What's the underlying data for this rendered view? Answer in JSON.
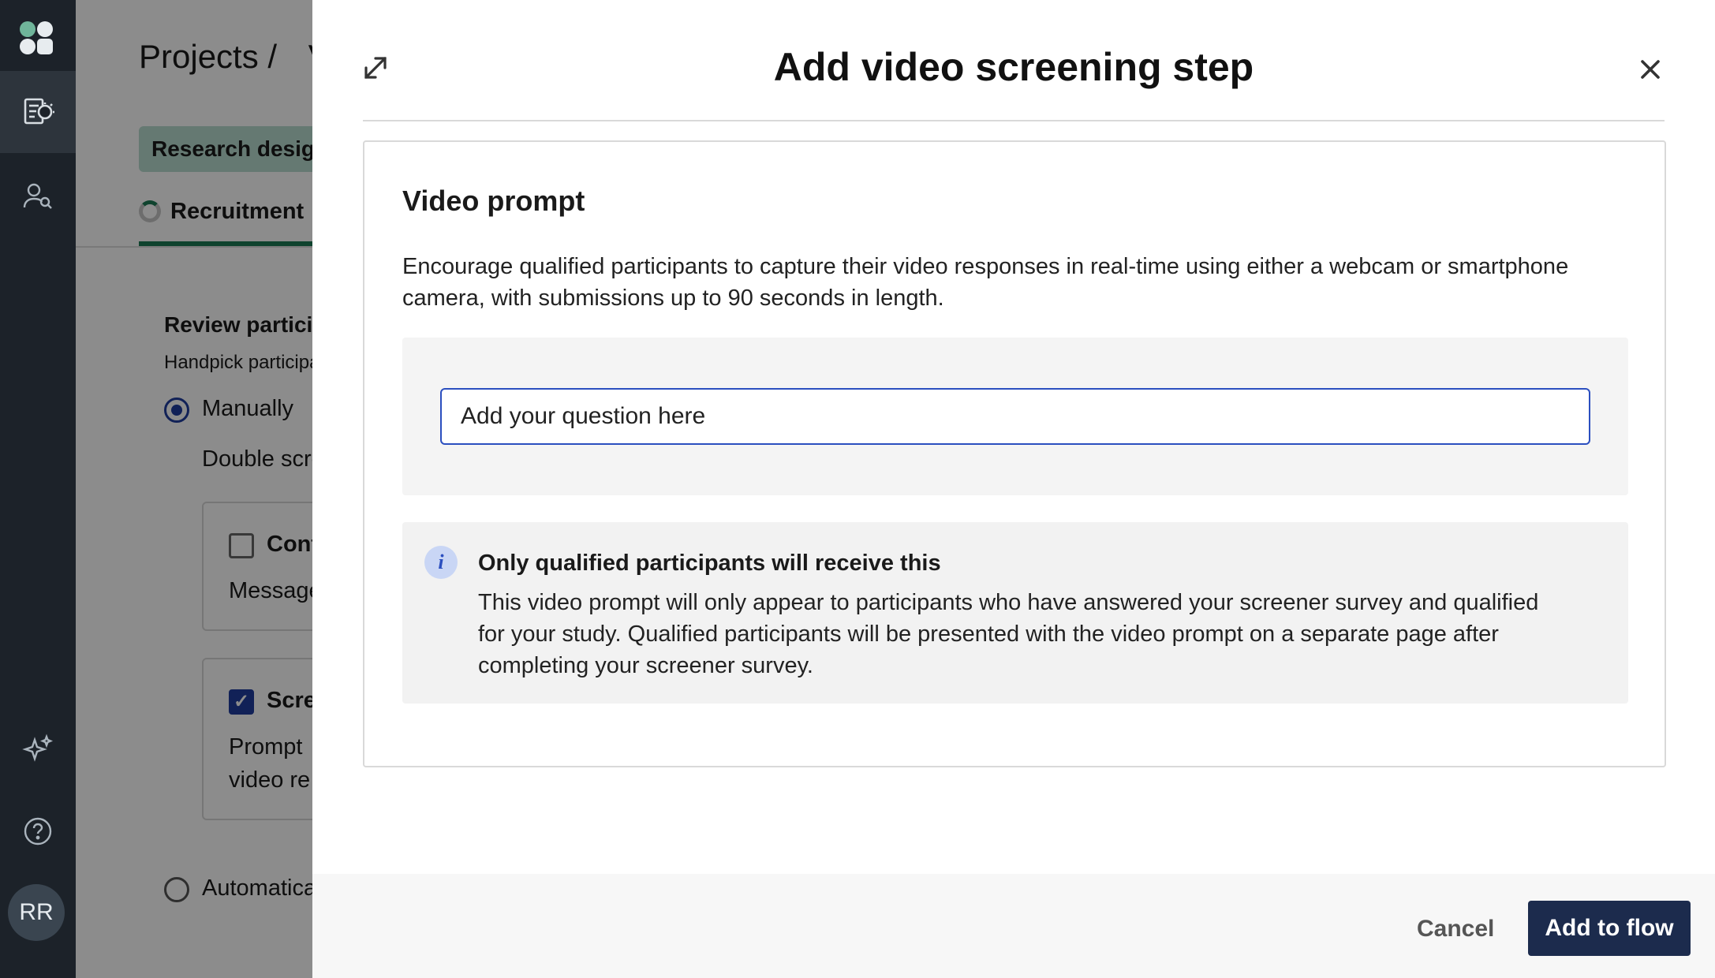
{
  "rail": {
    "avatar_initials": "RR",
    "active_item": "studies"
  },
  "background": {
    "breadcrumb": "Projects /",
    "breadcrumb_tail": "V",
    "pill": "Research design",
    "tab": "Recruitment",
    "section_title": "Review participants",
    "section_subtitle": "Handpick participants",
    "radio_manual": "Manually",
    "note": "Double screen",
    "card1": {
      "title": "Contact",
      "text": "Message"
    },
    "card2": {
      "title": "Screen",
      "text_line1": "Prompt",
      "text_line2": "video re"
    },
    "radio_auto": "Automatically"
  },
  "modal": {
    "title": "Add video screening step",
    "panel": {
      "title": "Video prompt",
      "description": "Encourage qualified participants to capture their video responses in real-time using either a webcam or smartphone camera, with submissions up to 90 seconds in length.",
      "question_value": "Add your question here",
      "info_title": "Only qualified participants will receive this",
      "info_text": "This video prompt will only appear to participants who have answered your screener survey and qualified for your study. Qualified participants will be presented with the video prompt on a separate page after completing your screener survey."
    },
    "footer": {
      "cancel_label": "Cancel",
      "primary_label": "Add to flow"
    }
  },
  "colors": {
    "rail_bg": "#1c2229",
    "primary_button": "#1c2b4d",
    "input_focus": "#2b4fbf",
    "brand_green": "#1d7a55"
  }
}
